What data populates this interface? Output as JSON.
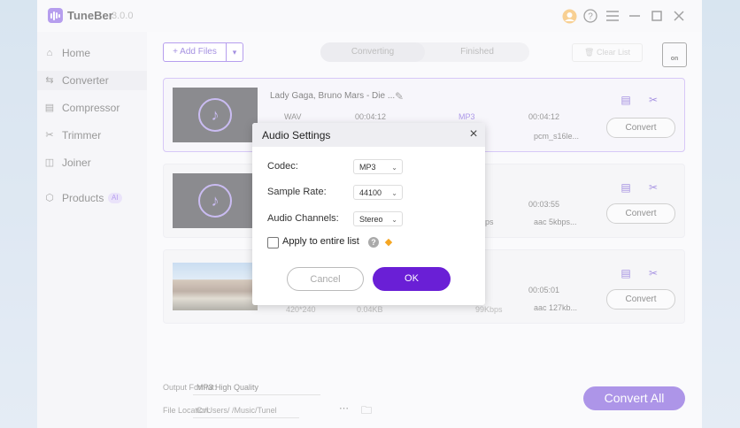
{
  "app": {
    "name": "TuneBer",
    "version": "3.0.0"
  },
  "sidebar": {
    "items": [
      {
        "label": "Home",
        "icon": "home-icon"
      },
      {
        "label": "Converter",
        "icon": "converter-icon",
        "active": true
      },
      {
        "label": "Compressor",
        "icon": "compressor-icon"
      },
      {
        "label": "Trimmer",
        "icon": "scissors-icon"
      },
      {
        "label": "Joiner",
        "icon": "joiner-icon"
      },
      {
        "label": "Products",
        "icon": "cube-icon",
        "badge": "AI"
      }
    ]
  },
  "toolbar": {
    "add_files": "+ Add Files",
    "tabs": [
      "Converting",
      "Finished"
    ],
    "clear_list": "Clear List",
    "hw_label": "on"
  },
  "files": [
    {
      "title": "Lady Gaga, Bruno Mars - Die ...",
      "src_format": "WAV",
      "src_duration": "00:04:12",
      "dst_format": "MP3",
      "dst_duration": "00:04:12",
      "dst_codec": "pcm_s16le...",
      "convert": "Convert"
    },
    {
      "title": "",
      "dst_duration": "00:03:55",
      "dst_codec": "aac 5kbps...",
      "src_bitrate": "bps",
      "convert": "Convert"
    },
    {
      "title": "",
      "src_res": "420*240",
      "src_size": "0.04KB",
      "dst_bitrate": "99Kbps",
      "dst_duration": "00:05:01",
      "dst_codec": "aac 127kb...",
      "convert": "Convert"
    }
  ],
  "bottom": {
    "output_format_label": "Output Format:",
    "output_format_value": "MP3 High Quality",
    "file_location_label": "File Location:",
    "file_location_value": "C:/Users/ /Music/Tunel",
    "convert_all": "Convert All"
  },
  "dialog": {
    "title": "Audio Settings",
    "codec_label": "Codec:",
    "codec_value": "MP3",
    "sample_rate_label": "Sample Rate:",
    "sample_rate_value": "44100",
    "channels_label": "Audio Channels:",
    "channels_value": "Stereo",
    "apply_label": "Apply to entire list",
    "cancel": "Cancel",
    "ok": "OK"
  },
  "colors": {
    "accent": "#6a3fd6",
    "ok_button": "#6a1fd6"
  }
}
